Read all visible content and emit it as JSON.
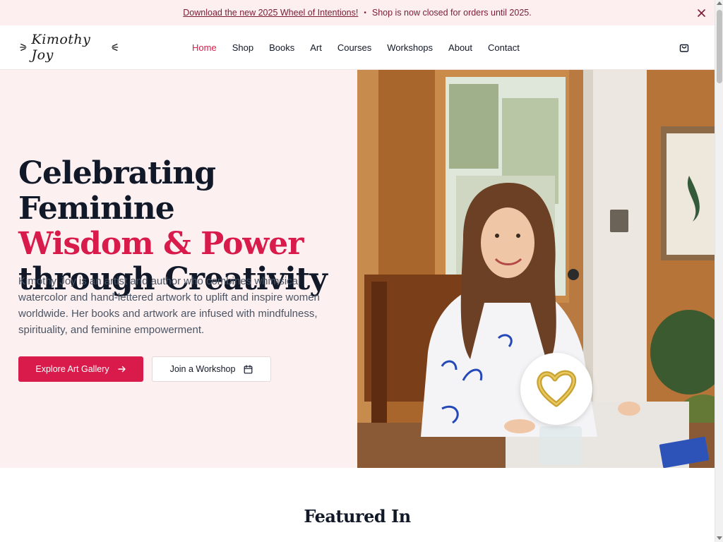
{
  "announcement": {
    "link_text": "Download the new 2025 Wheel of Intentions!",
    "separator": "•",
    "message": "Shop is now closed for orders until 2025.",
    "close_icon": "close-icon"
  },
  "header": {
    "logo_text": "Kimothy Joy",
    "nav": [
      {
        "label": "Home",
        "active": true
      },
      {
        "label": "Shop",
        "active": false
      },
      {
        "label": "Books",
        "active": false
      },
      {
        "label": "Art",
        "active": false
      },
      {
        "label": "Courses",
        "active": false
      },
      {
        "label": "Workshops",
        "active": false
      },
      {
        "label": "About",
        "active": false
      },
      {
        "label": "Contact",
        "active": false
      }
    ],
    "cart_icon": "shopping-bag-icon"
  },
  "hero": {
    "title_line1": "Celebrating Feminine",
    "title_line2": "Wisdom & Power",
    "title_line3": "through Creativity",
    "description": "Kimothy Joy is an artist and author who combines whimsical watercolor and hand-lettered artwork to uplift and inspire women worldwide. Her books and artwork are infused with mindfulness, spirituality, and feminine empowerment.",
    "primary_button": "Explore Art Gallery",
    "secondary_button": "Join a Workshop",
    "badge_icon": "gold-heart-icon"
  },
  "featured": {
    "heading": "Featured In"
  },
  "colors": {
    "accent": "#d81b4a",
    "hero_bg": "#fdf0f1",
    "announce_bg": "#fdeef0",
    "heading": "#111827"
  }
}
